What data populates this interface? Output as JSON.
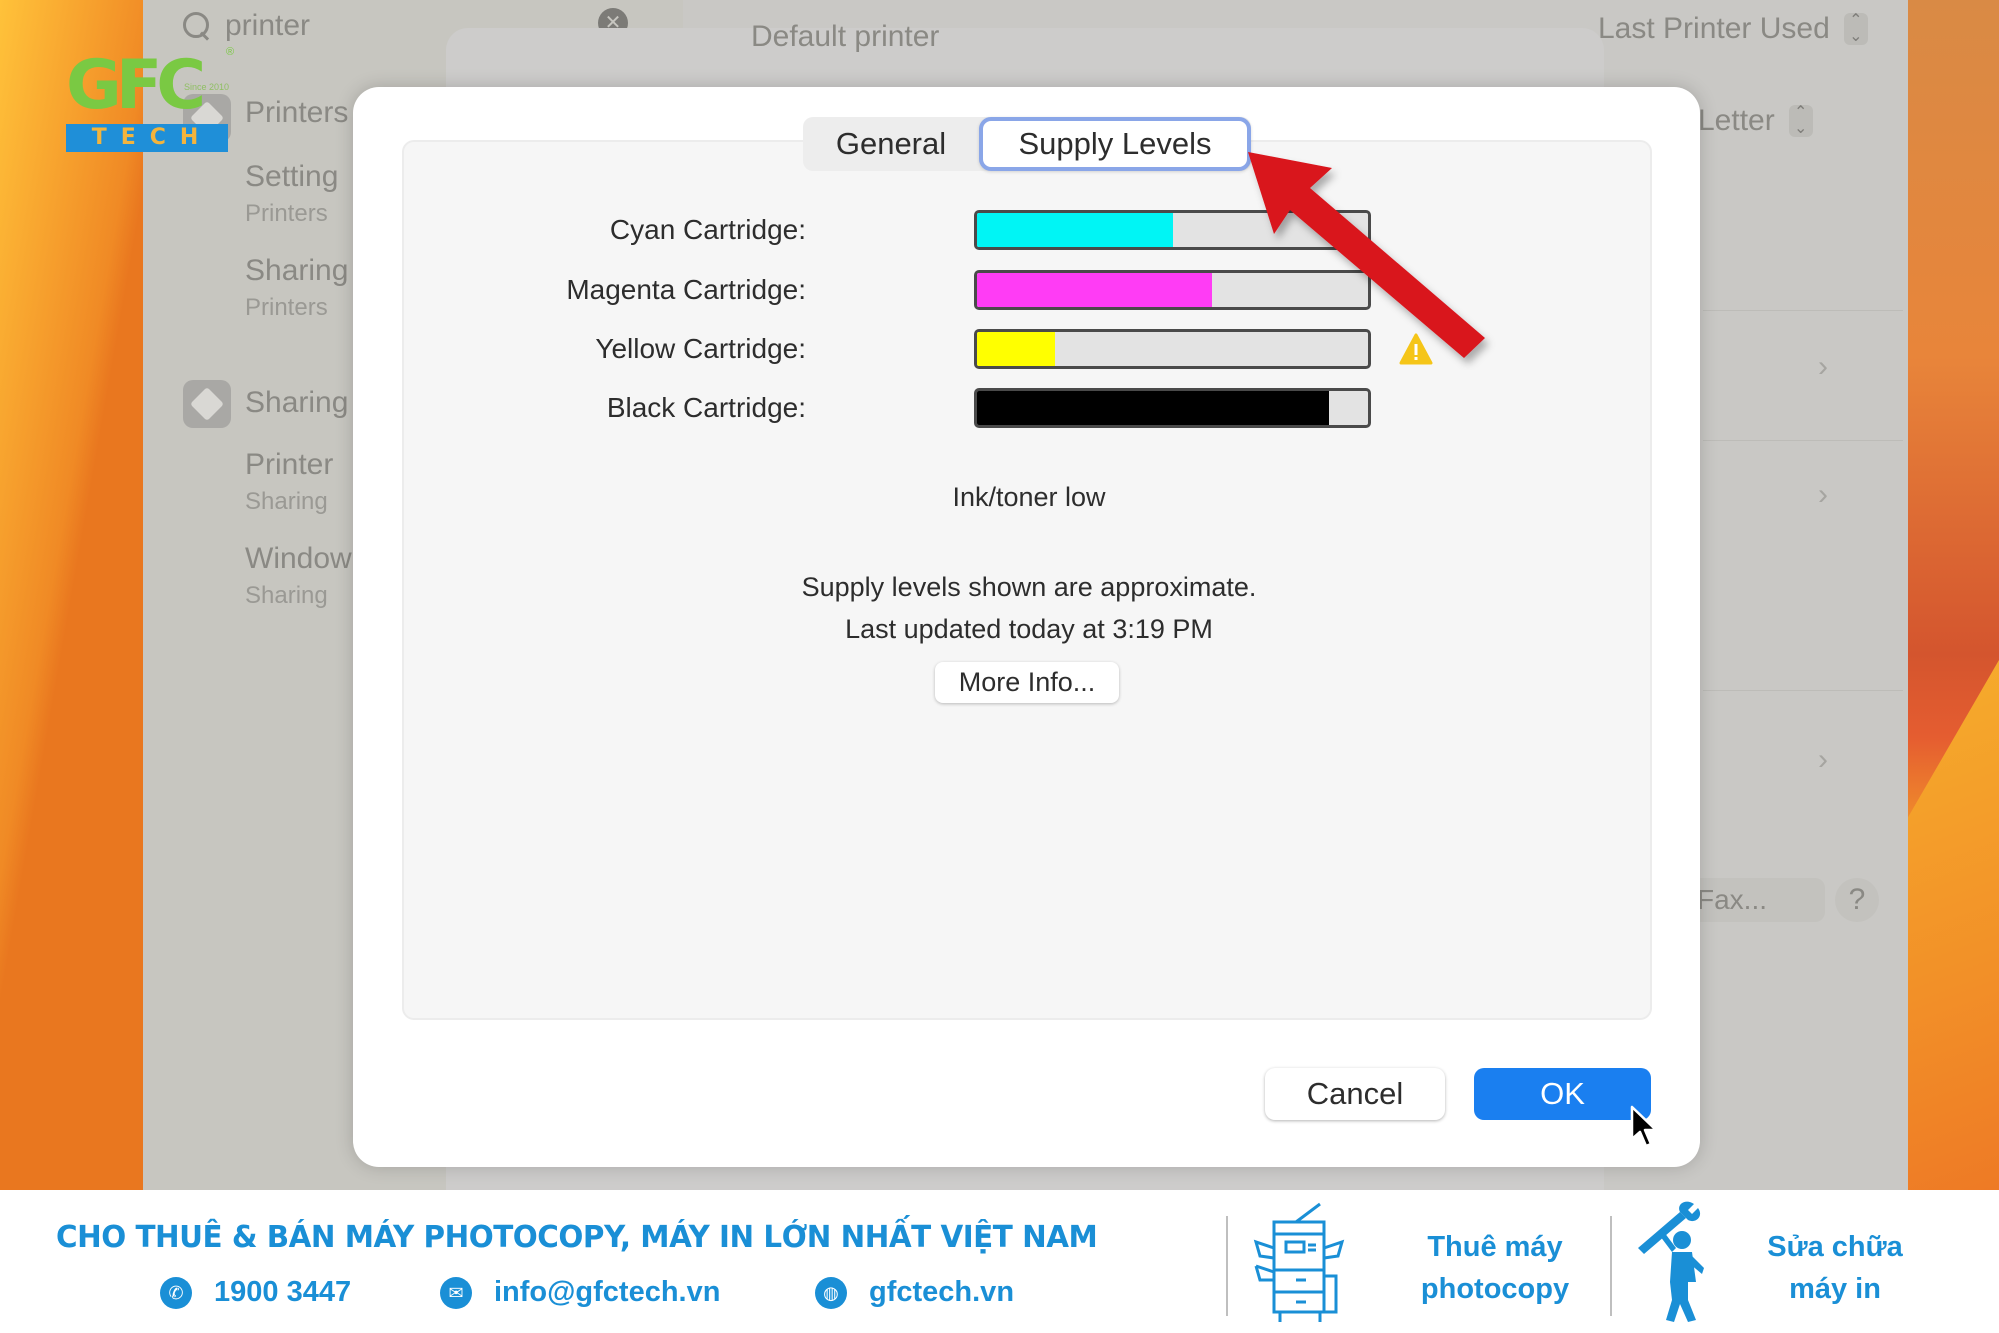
{
  "background_window": {
    "search": {
      "value": "printer"
    },
    "sidebar": {
      "items": [
        {
          "title": "Printers",
          "subtitle": ""
        },
        {
          "title": "Setting",
          "subtitle": "Printers"
        },
        {
          "title": "Sharing",
          "subtitle": "Printers"
        },
        {
          "title": "Sharing",
          "subtitle": ""
        },
        {
          "title": "Printer",
          "subtitle": "Sharing"
        },
        {
          "title": "Window",
          "subtitle": "Sharing"
        }
      ]
    },
    "default_printer_label": "Default printer",
    "default_printer_value": "Last Printer Used",
    "paper_size_value": "Letter",
    "fax_button": "Fax...",
    "help_button": "?"
  },
  "dialog": {
    "tabs": [
      {
        "label": "General",
        "selected": false
      },
      {
        "label": "Supply Levels",
        "selected": true
      }
    ],
    "supplies": [
      {
        "label": "Cyan Cartridge:",
        "level_percent": 50,
        "color": "#00f5f5",
        "warning": false
      },
      {
        "label": "Magenta Cartridge:",
        "level_percent": 60,
        "color": "#ff3cf5",
        "warning": false
      },
      {
        "label": "Yellow Cartridge:",
        "level_percent": 20,
        "color": "#ffff00",
        "warning": true
      },
      {
        "label": "Black Cartridge:",
        "level_percent": 90,
        "color": "#000000",
        "warning": false
      }
    ],
    "status": "Ink/toner low",
    "note_line1": "Supply levels shown are approximate.",
    "note_line2": "Last updated today at 3:19 PM",
    "more_info_button": "More Info...",
    "cancel_button": "Cancel",
    "ok_button": "OK",
    "accent_color": "#1a7ff0",
    "warning_color": "#f5c518",
    "annotation_arrow_color": "#d9121b"
  },
  "logo": {
    "text": "GFC",
    "tagline": "Since 2010",
    "sub": "TECH",
    "registered": "®"
  },
  "banner": {
    "headline": "CHO THUÊ & BÁN MÁY PHOTOCOPY, MÁY IN LỚN NHẤT VIỆT NAM",
    "phone": "1900 3447",
    "email": "info@gfctech.vn",
    "website": "gfctech.vn",
    "service1_line1": "Thuê máy",
    "service1_line2": "photocopy",
    "service2_line1": "Sửa chữa",
    "service2_line2": "máy in",
    "brand_color": "#1a8fd6"
  }
}
